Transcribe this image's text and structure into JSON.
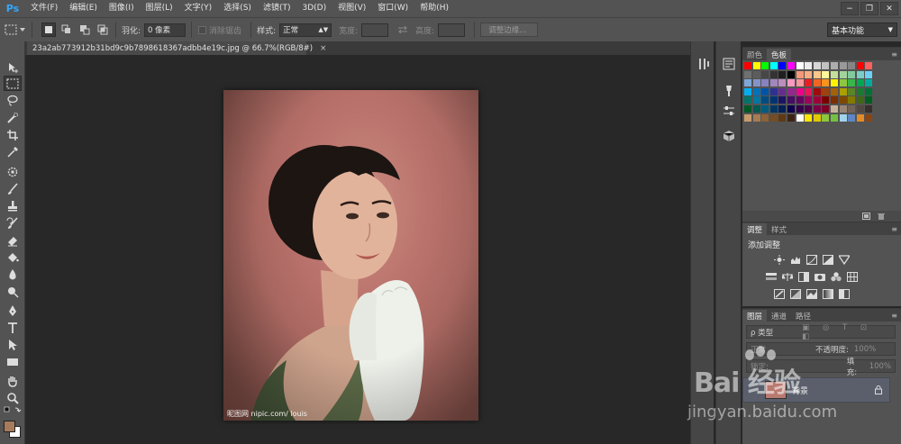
{
  "app": {
    "logo": "Ps"
  },
  "menu": [
    "文件(F)",
    "编辑(E)",
    "图像(I)",
    "图层(L)",
    "文字(Y)",
    "选择(S)",
    "滤镜(T)",
    "3D(D)",
    "视图(V)",
    "窗口(W)",
    "帮助(H)"
  ],
  "window_controls": {
    "minimize": "−",
    "restore": "❐",
    "close": "✕"
  },
  "options": {
    "feather_label": "羽化:",
    "feather_value": "0 像素",
    "antialias_label": "消除锯齿",
    "style_label": "样式:",
    "style_value": "正常",
    "width_label": "宽度:",
    "height_label": "高度:",
    "refine_edge_button": "调整边缘...",
    "workspace": "基本功能"
  },
  "document": {
    "tab_title": "23a2ab773912b31bd9c9b7898618367adbb4e19c.jpg @ 66.7%(RGB/8#)",
    "tab_close": "×",
    "image_watermark": "昵图网 nipic.com/ louis"
  },
  "swatches_panel": {
    "tabs": [
      "颜色",
      "色板"
    ],
    "active_tab": "色板",
    "colors": [
      "#ff0000",
      "#ffff00",
      "#00ff00",
      "#00ffff",
      "#0000ff",
      "#ff00ff",
      "#ffffff",
      "#ebebeb",
      "#d6d6d6",
      "#c2c2c2",
      "#adadad",
      "#999999",
      "#858585",
      "#ff0000",
      "#ff6060",
      "#707070",
      "#5c5c5c",
      "#474747",
      "#333333",
      "#1f1f1f",
      "#000000",
      "#f7977a",
      "#f9ad81",
      "#fdc68a",
      "#fff79a",
      "#c4df9b",
      "#a3d39c",
      "#82ca9d",
      "#7bcdc8",
      "#6ecff6",
      "#7ea7d8",
      "#8493ca",
      "#8882be",
      "#a187be",
      "#bc8dbf",
      "#f49ac2",
      "#f6989d",
      "#ed1c24",
      "#f26522",
      "#f7941d",
      "#fff200",
      "#8dc73f",
      "#39b54a",
      "#00a651",
      "#00a99d",
      "#00aeef",
      "#0072bc",
      "#0054a6",
      "#2e3192",
      "#662d91",
      "#92278f",
      "#ec008c",
      "#ed145b",
      "#9e0b0f",
      "#a0410d",
      "#a3620a",
      "#aba000",
      "#598527",
      "#1a7b30",
      "#007236",
      "#00746b",
      "#0076a3",
      "#004b80",
      "#003471",
      "#1b1464",
      "#440e62",
      "#630460",
      "#9e005d",
      "#9e0039",
      "#790000",
      "#7b2e00",
      "#7d4900",
      "#827b00",
      "#406618",
      "#005e20",
      "#005826",
      "#005952",
      "#005b7f",
      "#003663",
      "#002157",
      "#0d004c",
      "#32004b",
      "#4b0049",
      "#7b0046",
      "#7a0026",
      "#c7b299",
      "#998675",
      "#736357",
      "#534741",
      "#37302d",
      "#c69c6d",
      "#a67c52",
      "#8c6239",
      "#754c24",
      "#603913",
      "#3c2415",
      "#ffffff",
      "#ffe600",
      "#e1c800",
      "#8dc73f",
      "#74c043",
      "#a0d4eb",
      "#5f85c4",
      "#e38b27",
      "#8b4513"
    ],
    "footer_icons": [
      "new-swatch-icon",
      "trash-icon"
    ]
  },
  "adjustments_panel": {
    "tabs": [
      "调整",
      "样式"
    ],
    "active_tab": "调整",
    "title": "添加调整"
  },
  "layers_panel": {
    "tabs": [
      "图层",
      "通道",
      "路径"
    ],
    "active_tab": "图层",
    "filter_label": "ρ 类型",
    "blend_mode": "正常",
    "opacity_label": "不透明度:",
    "opacity_value": "100%",
    "lock_label": "锁定:",
    "fill_label": "填充:",
    "fill_value": "100%",
    "layer_name": "背景"
  },
  "watermark": {
    "logo_text": "Bai 经验",
    "url": "jingyan.baidu.com"
  }
}
